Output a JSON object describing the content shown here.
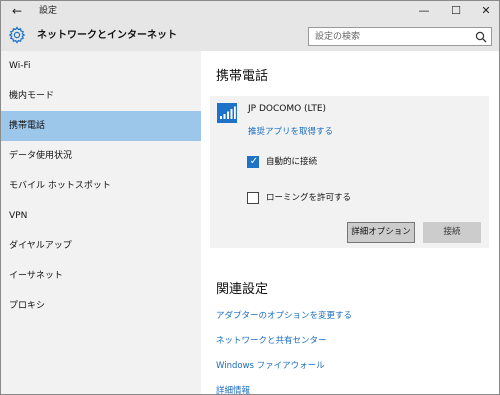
{
  "window": {
    "title": "設定",
    "back_glyph": "←",
    "min_glyph": "—",
    "max_glyph": "☐",
    "close_glyph": "✕"
  },
  "header": {
    "title": "ネットワークとインターネット",
    "icon": "gear-icon",
    "search_placeholder": "設定の検索",
    "search_icon": "search-icon"
  },
  "sidebar": {
    "items": [
      {
        "label": "Wi-Fi",
        "active": false
      },
      {
        "label": "機内モード",
        "active": false
      },
      {
        "label": "携帯電話",
        "active": true
      },
      {
        "label": "データ使用状況",
        "active": false
      },
      {
        "label": "モバイル ホットスポット",
        "active": false
      },
      {
        "label": "VPN",
        "active": false
      },
      {
        "label": "ダイヤルアップ",
        "active": false
      },
      {
        "label": "イーサネット",
        "active": false
      },
      {
        "label": "プロキシ",
        "active": false
      }
    ]
  },
  "main": {
    "cellular": {
      "title": "携帯電話",
      "network_name": "JP DOCOMO (LTE)",
      "network_icon": "cellular-signal-icon",
      "get_app_link": "推奨アプリを取得する",
      "auto_connect": {
        "label": "自動的に接続",
        "checked": true
      },
      "roaming": {
        "label": "ローミングを許可する",
        "checked": false
      },
      "advanced_button": "詳細オプション",
      "connect_button": "接続"
    },
    "related": {
      "title": "関連設定",
      "links": [
        "アダプターのオプションを変更する",
        "ネットワークと共有センター",
        "Windows ファイアウォール",
        "詳細情報"
      ]
    }
  },
  "colors": {
    "accent": "#1e73c8",
    "link": "#1a6dbf",
    "selected_nav": "#9dc7ea",
    "chrome": "#e6e6e6",
    "sidebar": "#f2f2f2"
  }
}
